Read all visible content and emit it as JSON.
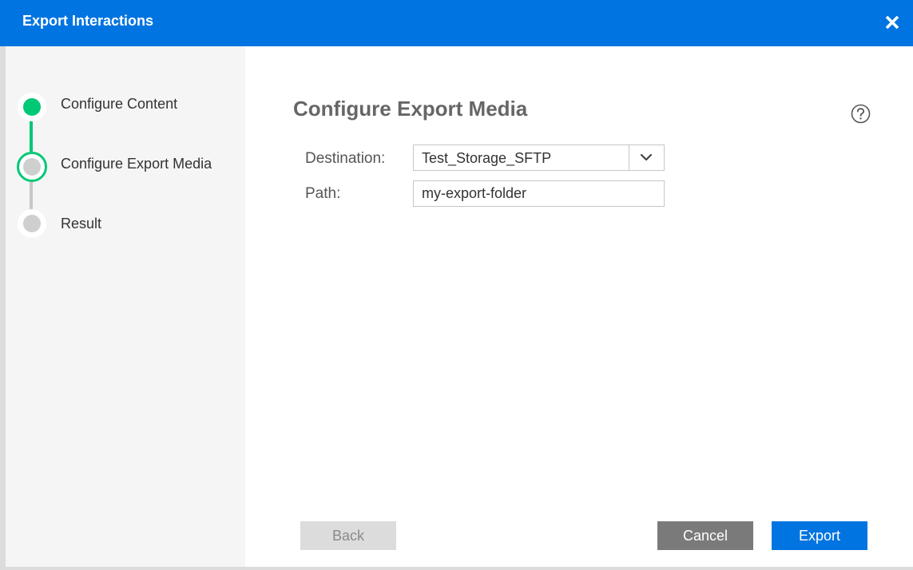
{
  "dialog": {
    "title": "Export Interactions",
    "close_icon": "close-icon"
  },
  "steps": [
    {
      "label": "Configure Content",
      "status": "complete"
    },
    {
      "label": "Configure Export Media",
      "status": "current"
    },
    {
      "label": "Result",
      "status": "pending"
    }
  ],
  "main": {
    "section_title": "Configure Export Media",
    "help_icon": "help-icon",
    "destination": {
      "label": "Destination:",
      "value": "Test_Storage_SFTP",
      "arrow_icon": "chevron-down-icon"
    },
    "path": {
      "label": "Path:",
      "value": "my-export-folder"
    }
  },
  "buttons": {
    "back": "Back",
    "cancel": "Cancel",
    "export": "Export"
  },
  "colors": {
    "accent": "#0074e0",
    "step_complete": "#00c875",
    "step_pending": "#cfcfcf",
    "cancel_bg": "#7a7a7a",
    "back_bg": "#dcdcdc"
  }
}
